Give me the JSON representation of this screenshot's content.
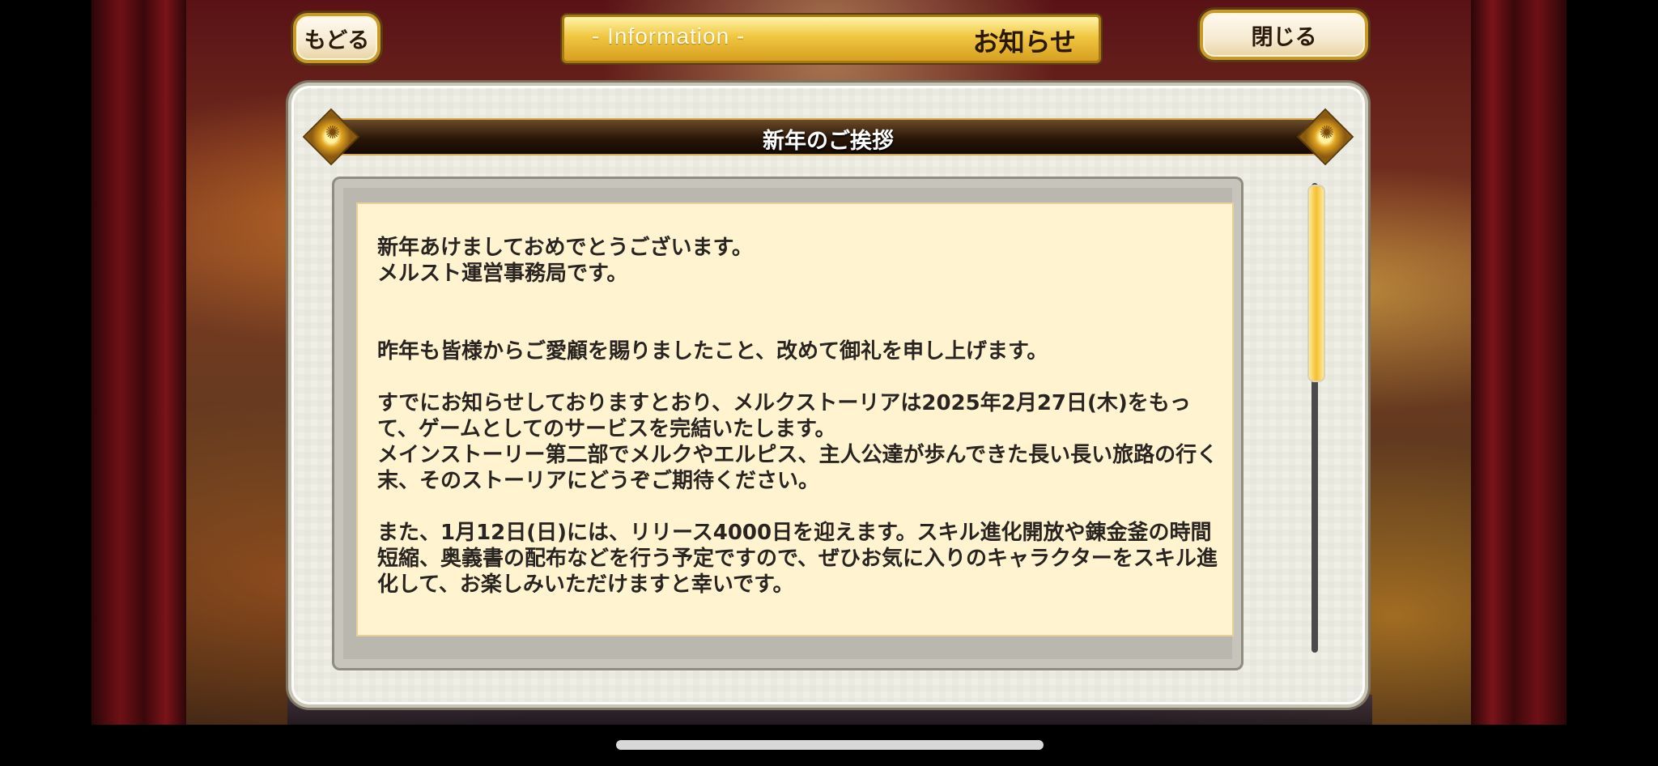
{
  "header": {
    "back_label": "もどる",
    "close_label": "閉じる",
    "info_en": "- Information -",
    "info_jp": "お知らせ"
  },
  "notice": {
    "title": "新年のご挨拶",
    "body": "新年あけましておめでとうございます。\nメルスト運営事務局です。\n\n\n昨年も皆様からご愛顧を賜りましたこと、改めて御礼を申し上げます。\n\nすでにお知らせしておりますとおり、メルクストーリアは2025年2月27日(木)をもって、ゲームとしてのサービスを完結いたします。\nメインストーリー第二部でメルクやエルピス、主人公達が歩んできた長い長い旅路の行く末、そのストーリアにどうぞご期待ください。\n\nまた、1月12日(日)には、リリース4000日を迎えます。スキル進化開放や錬金釜の時間短縮、奥義書の配布などを行う予定ですので、ぜひお気に入りのキャラクターをスキル進化して、お楽しみいただけますと幸いです。"
  },
  "colors": {
    "accent_gold": "#f0c640",
    "paper": "#fff3d0",
    "title_bar": "#2a1608"
  }
}
